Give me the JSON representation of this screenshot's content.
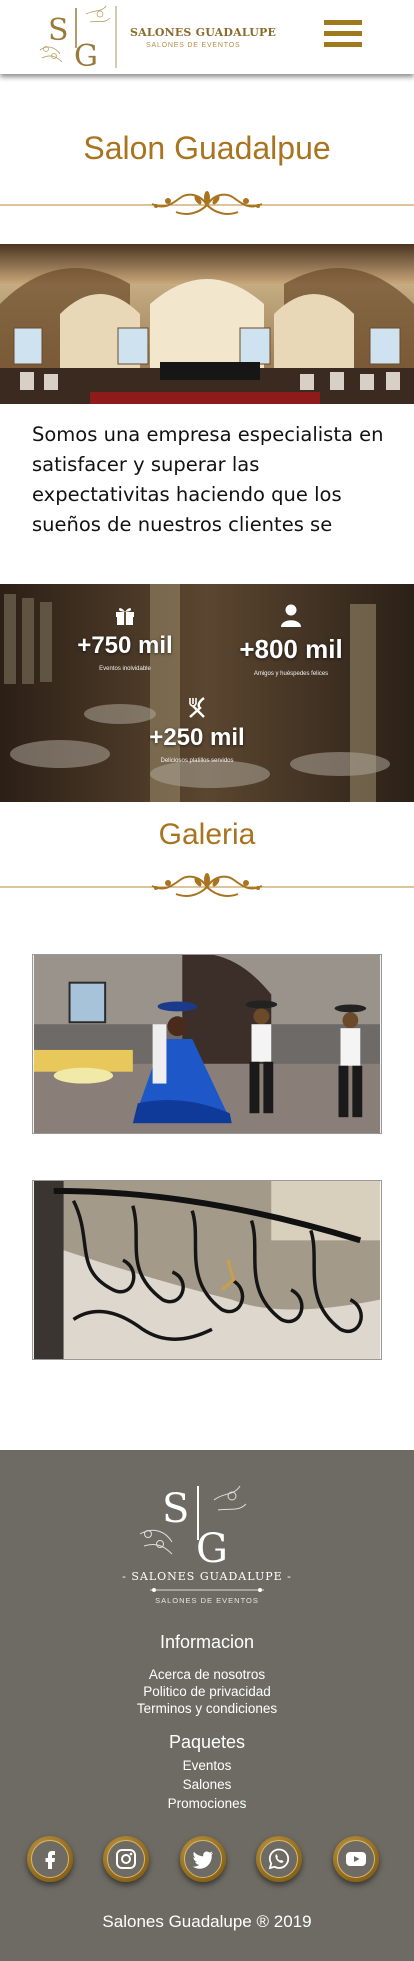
{
  "header": {
    "brand": "SALONES GUADALUPE",
    "subtitle": "SALONES DE EVENTOS",
    "monogram": "SG"
  },
  "main": {
    "title": "Salon Guadalpue",
    "intro": "Somos una empresa especialista en satisfacer y superar las expectativitas haciendo que los sueños de nuestros clientes se"
  },
  "stats": [
    {
      "icon": "gift-icon",
      "value": "+750 mil",
      "label": "Eventos inolvidable"
    },
    {
      "icon": "user-icon",
      "value": "+800 mil",
      "label": "Amigos y huéspedes felices"
    },
    {
      "icon": "utensils-icon",
      "value": "+250 mil",
      "label": "Deliciosos platillos servidos"
    }
  ],
  "gallery": {
    "title": "Galeria"
  },
  "footer": {
    "brand": "- SALONES GUADALUPE -",
    "subtitle": "SALONES DE EVENTOS",
    "monogram": "SG",
    "info_heading": "Informacion",
    "info_links": [
      "Acerca de nosotros",
      "Politico de privacidad",
      "Terminos y condiciones"
    ],
    "packages_heading": "Paquetes",
    "package_links": [
      "Eventos",
      "Salones",
      "Promociones"
    ],
    "social": [
      "facebook-icon",
      "instagram-icon",
      "twitter-icon",
      "whatsapp-icon",
      "youtube-icon"
    ],
    "copyright": "Salones Guadalupe ® 2019"
  },
  "colors": {
    "gold": "#a9741f",
    "footer_bg": "#6d6b63"
  }
}
